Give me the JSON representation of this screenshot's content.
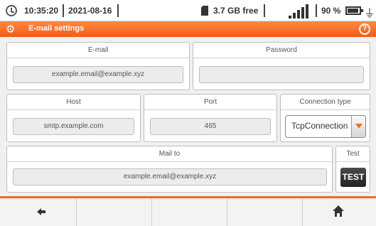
{
  "status_bar": {
    "time": "10:35:20",
    "date": "2021-08-16",
    "storage": "3.7 GB free",
    "battery": "90 %",
    "icons": [
      "clock-icon",
      "sd-card-icon",
      "signal-icon",
      "battery-icon",
      "plug-icon"
    ]
  },
  "title_bar": {
    "title": "E-mail settings",
    "icons": [
      "settings-gear-icon",
      "help-icon"
    ],
    "help_glyph": "?"
  },
  "form": {
    "email": {
      "label": "E-mail",
      "value": "example.email@example.xyz"
    },
    "password": {
      "label": "Password",
      "value": ""
    },
    "host": {
      "label": "Host",
      "value": "smtp.example.com"
    },
    "port": {
      "label": "Port",
      "value": "465"
    },
    "connection_type": {
      "label": "Connection type",
      "value": "TcpConnection"
    },
    "mail_to": {
      "label": "Mail to",
      "value": "example.email@example.xyz"
    },
    "test": {
      "label": "Test",
      "button": "TEST"
    }
  },
  "bottom_bar": {
    "icons": [
      "back-arrow-icon",
      "home-icon"
    ]
  },
  "colors": {
    "accent": "#f26a22",
    "header_gradient": [
      "#ff8a3d",
      "#f35b18"
    ]
  }
}
